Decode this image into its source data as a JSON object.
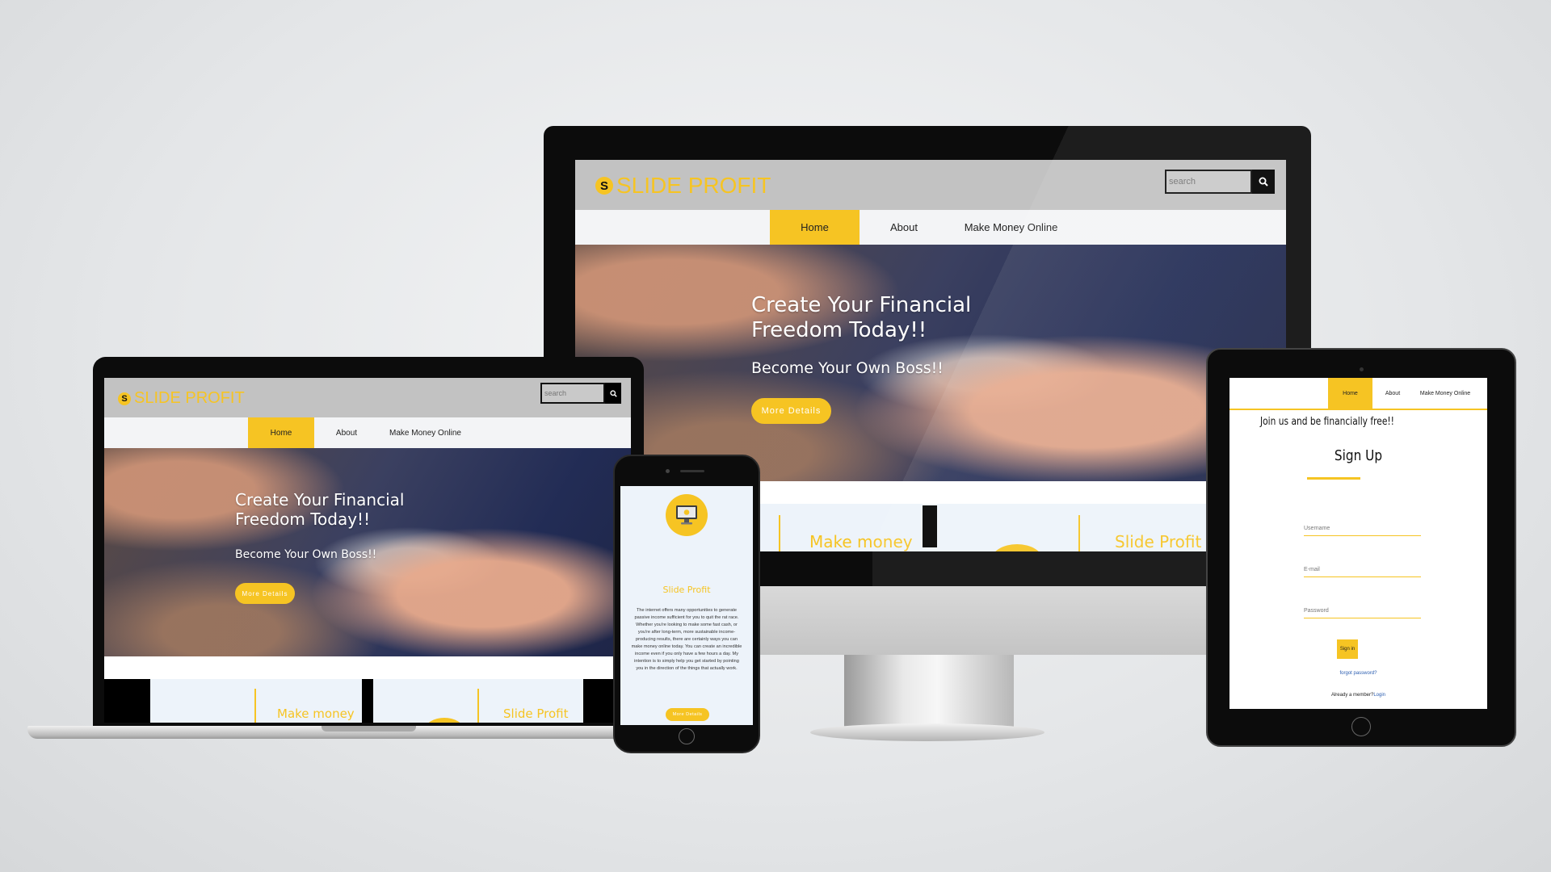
{
  "site": {
    "brand": "SLIDE PROFIT",
    "logo_letter": "S",
    "search_placeholder": "search",
    "nav": [
      "Home",
      "About",
      "Make Money Online"
    ],
    "hero": {
      "title": "Create Your Financial Freedom Today!!",
      "subtitle": "Become Your Own Boss!!",
      "button": "More Details"
    },
    "strip": [
      "Make money",
      "Slide Profit"
    ]
  },
  "phone": {
    "heading": "Slide Profit",
    "body": "The internet offers many opportunities to generate passive income sufficient for you to quit the rat race. Whether you're looking to make some fast cash, or you're after long-term, more sustainable income-producing results, there are certainly ways you can make money online today. You can create an incredible income even if you only have a few hours a day. My intention is to simply help you get started by pointing you in the direction of the things that actually work.",
    "button": "More Details"
  },
  "tablet": {
    "tagline": "Join us and be financially free!!",
    "title": "Sign Up",
    "fields": [
      "Username",
      "E-mail",
      "Password"
    ],
    "signin": "Sign in",
    "forgot": "forgot password?",
    "member_prefix": "Already a member?",
    "member_link": "Login"
  },
  "colors": {
    "accent": "#f6c423",
    "topbar": "#c2c2c2",
    "navbar": "#f3f4f6",
    "strip": "#edf3fa"
  },
  "icons": [
    "search-icon",
    "monitor-icon"
  ]
}
